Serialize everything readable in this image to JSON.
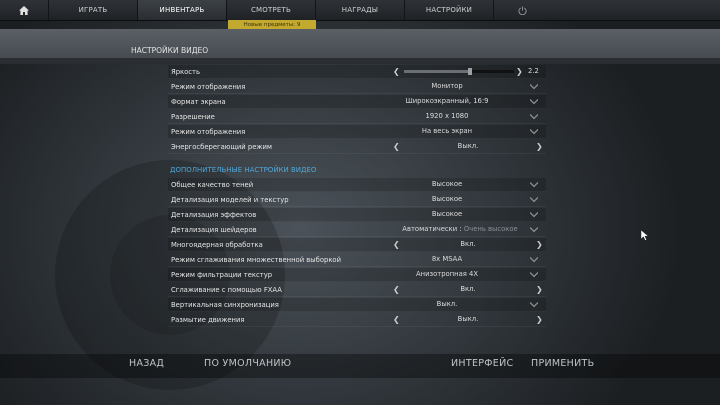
{
  "nav": {
    "items": [
      {
        "label": "ИГРАТЬ"
      },
      {
        "label": "ИНВЕНТАРЬ",
        "active": true
      },
      {
        "label": "СМОТРЕТЬ"
      },
      {
        "label": "НАГРАДЫ"
      },
      {
        "label": "НАСТРОЙКИ"
      }
    ],
    "badge": "Новые предметы: 9"
  },
  "section_title": "НАСТРОЙКИ ВИДЕО",
  "basic": {
    "brightness": {
      "label": "Яркость",
      "value": "2.2",
      "level_fraction": 0.6
    },
    "display_mode": {
      "label": "Режим отображения",
      "value": "Монитор"
    },
    "aspect": {
      "label": "Формат экрана",
      "value": "Широкоэкранный, 16:9"
    },
    "resolution": {
      "label": "Разрешение",
      "value": "1920 x 1080"
    },
    "display_mode2": {
      "label": "Режим отображения",
      "value": "На весь экран"
    },
    "power_saving": {
      "label": "Энергосберегающий режим",
      "value": "Выкл."
    }
  },
  "advanced_title": "ДОПОЛНИТЕЛЬНЫЕ НАСТРОЙКИ ВИДЕО",
  "advanced": {
    "shadows": {
      "label": "Общее качество теней",
      "value": "Высокое"
    },
    "models": {
      "label": "Детализация моделей и текстур",
      "value": "Высокое"
    },
    "effects": {
      "label": "Детализация эффектов",
      "value": "Высокое"
    },
    "shaders": {
      "label": "Детализация шейдеров",
      "value": "Автоматически :",
      "value_dim": "Очень высокое"
    },
    "multicore": {
      "label": "Многоядерная обработка",
      "value": "Вкл."
    },
    "msaa": {
      "label": "Режим сглаживания множественной выборкой",
      "value": "8x MSAA"
    },
    "filtering": {
      "label": "Режим фильтрации текстур",
      "value": "Анизотропная 4X"
    },
    "fxaa": {
      "label": "Сглаживание с помощью FXAA",
      "value": "Вкл."
    },
    "vsync": {
      "label": "Вертикальная синхронизация",
      "value": "Выкл."
    },
    "motion_blur": {
      "label": "Размытие движения",
      "value": "Выкл."
    }
  },
  "footer": {
    "back": "НАЗАД",
    "defaults": "ПО УМОЛЧАНИЮ",
    "interface": "ИНТЕРФЕЙС",
    "apply": "ПРИМЕНИТЬ"
  },
  "colors": {
    "accent": "#4fa7d9",
    "badge": "#c3aa2f"
  }
}
